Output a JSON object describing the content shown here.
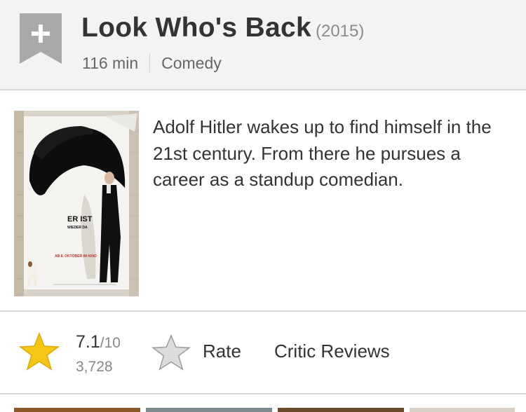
{
  "movie": {
    "title": "Look Who's Back",
    "year": "(2015)",
    "runtime": "116 min",
    "genre": "Comedy",
    "plot": "Adolf Hitler wakes up to find himself in the 21st century. From there he pursues a career as a standup comedian."
  },
  "watchlist": {
    "icon": "plus-ribbon-icon",
    "color": "#a9a9a9"
  },
  "poster": {
    "text_main": "ER IST",
    "text_sub": "WIEDER DA",
    "text_date": "AB 8. OKTOBER IM KINO"
  },
  "rating": {
    "value": "7.1",
    "max": "/10",
    "count": "3,728",
    "star_color": "#f5c518"
  },
  "actions": {
    "rate_label": "Rate",
    "critic_reviews_label": "Critic Reviews"
  },
  "colors": {
    "header_bg": "#f3f3f3",
    "divider": "#d9d9d9",
    "text": "#333333",
    "muted": "#888888"
  }
}
